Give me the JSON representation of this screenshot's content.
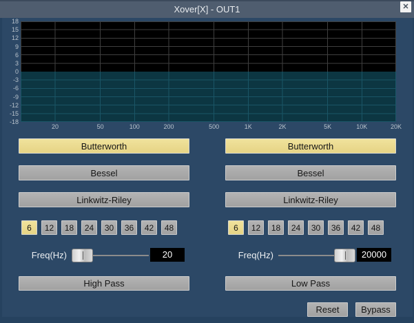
{
  "window": {
    "title": "Xover[X] - OUT1",
    "close_label": "✕"
  },
  "graph": {
    "y_ticks": [
      "18",
      "15",
      "12",
      "9",
      "6",
      "3",
      "0",
      "-3",
      "-6",
      "-9",
      "-12",
      "-15",
      "-18"
    ],
    "x_ticks": [
      "20",
      "50",
      "100",
      "200",
      "500",
      "1K",
      "2K",
      "5K",
      "10K",
      "20K"
    ],
    "x_tick_pos": [
      50,
      115.7,
      165.3,
      215,
      280.7,
      330.3,
      380,
      445.7,
      495.3,
      545
    ],
    "y_range_db": [
      -18,
      18
    ],
    "response_db": 0,
    "fill": "below-curve"
  },
  "channels": [
    {
      "filters": [
        "Butterworth",
        "Bessel",
        "Linkwitz-Riley"
      ],
      "selected_filter": "Butterworth",
      "slopes": [
        "6",
        "12",
        "18",
        "24",
        "30",
        "36",
        "42",
        "48"
      ],
      "selected_slope": "6",
      "freq_label": "Freq(Hz)",
      "freq_value": "20",
      "slider_percent": 0,
      "pass_label": "High Pass"
    },
    {
      "filters": [
        "Butterworth",
        "Bessel",
        "Linkwitz-Riley"
      ],
      "selected_filter": "Butterworth",
      "slopes": [
        "6",
        "12",
        "18",
        "24",
        "30",
        "36",
        "42",
        "48"
      ],
      "selected_slope": "6",
      "freq_label": "Freq(Hz)",
      "freq_value": "20000",
      "slider_percent": 100,
      "pass_label": "Low Pass"
    }
  ],
  "footer": {
    "reset": "Reset",
    "bypass": "Bypass"
  },
  "colors": {
    "window_bg": "#2c4866",
    "titlebar_bg": "#4f5d6f",
    "edge_bg": "#26425f",
    "plot_top_bg": "#000000",
    "plot_fill_teal": "#0c3642",
    "grid_gray": "#3f3f3f",
    "grid_teal": "#1a5566",
    "selected_yellow": "#ecdd92",
    "button_gray": "#a8a8a8",
    "axis_text": "#b9c3cc"
  }
}
